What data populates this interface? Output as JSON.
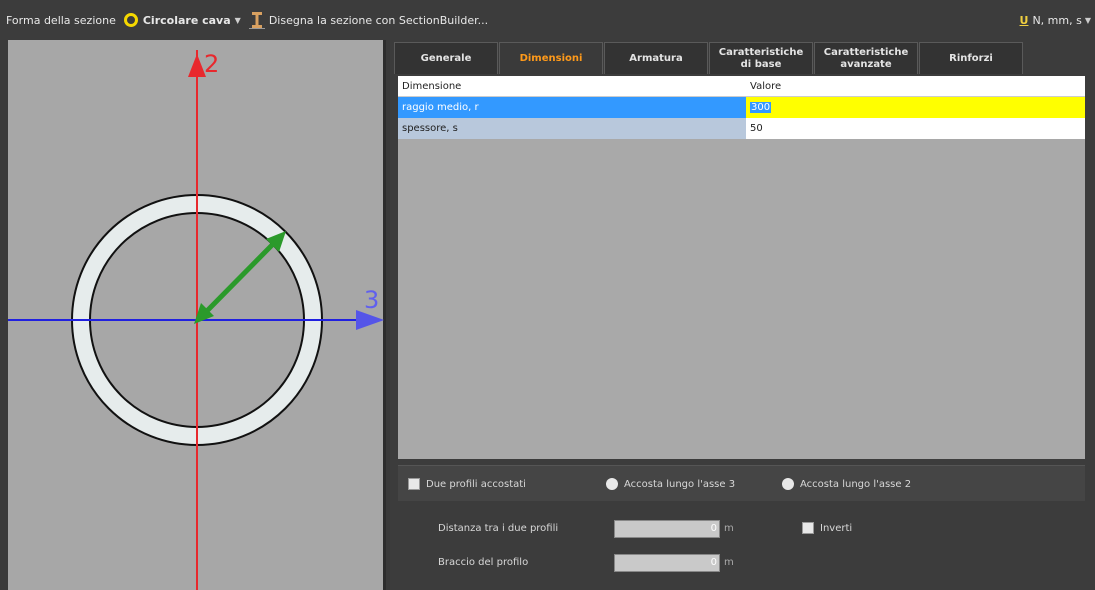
{
  "toolbar": {
    "shape_label": "Forma della sezione",
    "shape_value": "Circolare cava",
    "builder_label": "Disegna la sezione con SectionBuilder...",
    "units_value": "N, mm, s"
  },
  "drawing": {
    "axis_vertical_label": "2",
    "axis_horizontal_label": "3",
    "colors": {
      "vertical_axis": "#e8282d",
      "horizontal_axis": "#2020e0",
      "arrow": "#2b9a2b"
    }
  },
  "tabs": [
    {
      "label": "Generale"
    },
    {
      "label": "Dimensioni"
    },
    {
      "label": "Armatura"
    },
    {
      "label": "Caratteristiche di base"
    },
    {
      "label": "Caratteristiche avanzate"
    },
    {
      "label": "Rinforzi"
    }
  ],
  "grid": {
    "columns": [
      "Dimensione",
      "Valore"
    ],
    "rows": [
      {
        "name": "raggio medio, r",
        "value": "300"
      },
      {
        "name": "spessore, s",
        "value": "50"
      }
    ]
  },
  "bottom": {
    "due_profili_label": "Due profili accostati",
    "accosta3_label": "Accosta lungo l'asse 3",
    "accosta2_label": "Accosta lungo l'asse 2",
    "distanza_label": "Distanza tra i due profili",
    "distanza_value": "0",
    "distanza_unit": "m",
    "braccio_label": "Braccio del profilo",
    "braccio_value": "0",
    "braccio_unit": "m",
    "inverti_label": "Inverti"
  }
}
